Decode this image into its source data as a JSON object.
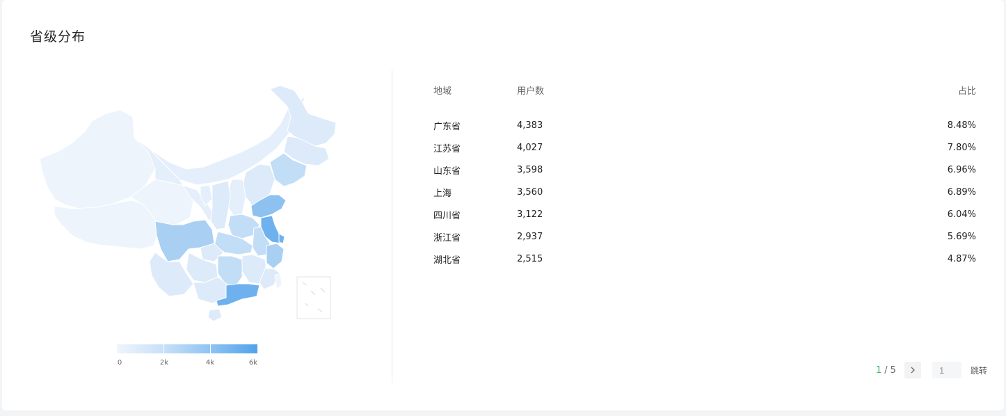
{
  "card": {
    "title": "省级分布"
  },
  "legend": {
    "ticks": [
      "0",
      "2k",
      "4k",
      "6k"
    ],
    "colors": [
      "#eef5fd",
      "#c8e0f8",
      "#8fc4f2",
      "#52a2ea"
    ]
  },
  "table": {
    "headers": {
      "region": "地域",
      "users": "用户数",
      "share": "占比"
    },
    "rows": [
      {
        "region": "广东省",
        "users": "4,383",
        "share": "8.48%"
      },
      {
        "region": "江苏省",
        "users": "4,027",
        "share": "7.80%"
      },
      {
        "region": "山东省",
        "users": "3,598",
        "share": "6.96%"
      },
      {
        "region": "上海",
        "users": "3,560",
        "share": "6.89%"
      },
      {
        "region": "四川省",
        "users": "3,122",
        "share": "6.04%"
      },
      {
        "region": "浙江省",
        "users": "2,937",
        "share": "5.69%"
      },
      {
        "region": "湖北省",
        "users": "2,515",
        "share": "4.87%"
      }
    ]
  },
  "pagination": {
    "current": "1",
    "total": "5",
    "jump_value": "1",
    "jump_label": "跳转"
  },
  "map": {
    "colors": {
      "lightest": "#edf4fc",
      "light": "#dceafa",
      "mid": "#c2ddf6",
      "strong": "#8cc1f0",
      "strongest": "#6eb1ee",
      "border": "#ffffff"
    }
  }
}
